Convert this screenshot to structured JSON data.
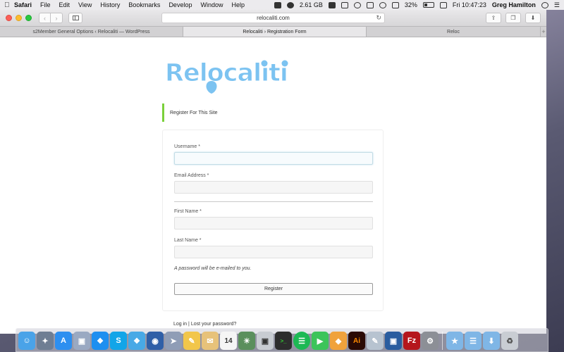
{
  "menubar": {
    "app_name": "Safari",
    "items": [
      "File",
      "Edit",
      "View",
      "History",
      "Bookmarks",
      "Develop",
      "Window",
      "Help"
    ],
    "memory": "2.61 GB",
    "battery": "32%",
    "clock": "Fri 10:47:23",
    "user": "Greg Hamilton"
  },
  "browser": {
    "url": "relocaliti.com",
    "tabs": [
      {
        "label": "s2Member General Options ‹ Relocaliti — WordPress"
      },
      {
        "label": "Relocaliti › Registration Form"
      },
      {
        "label": "Reloc"
      }
    ]
  },
  "page": {
    "logo_text": "Relocaliti",
    "notice": "Register For This Site",
    "fields": {
      "username_label": "Username *",
      "email_label": "Email Address *",
      "first_name_label": "First Name *",
      "last_name_label": "Last Name *"
    },
    "password_note": "A password will be e-mailed to you.",
    "register_button": "Register",
    "login_link": "Log in",
    "link_separator": "|",
    "lost_password_link": "Lost your password?"
  },
  "colors": {
    "logo_blue": "#7cc3f1",
    "notice_green": "#7ad03a"
  },
  "dock": {
    "icons": [
      "finder-icon",
      "launchpad-icon",
      "app-store-icon",
      "preview-icon",
      "safari-icon",
      "skype-icon",
      "twitter-icon",
      "activity-icon",
      "airdrop-icon",
      "notes-icon",
      "calendar-icon",
      "photo-icon",
      "iphoto-icon",
      "terminal-icon",
      "spotify-icon",
      "facetime-icon",
      "sketch-icon",
      "illustrator-icon",
      "textwrangler-icon",
      "sourcetree-icon",
      "filezilla-icon",
      "system-preferences-icon",
      "applications-folder-icon",
      "documents-folder-icon",
      "downloads-folder-icon",
      "trash-icon"
    ],
    "calendar_day": "14"
  }
}
